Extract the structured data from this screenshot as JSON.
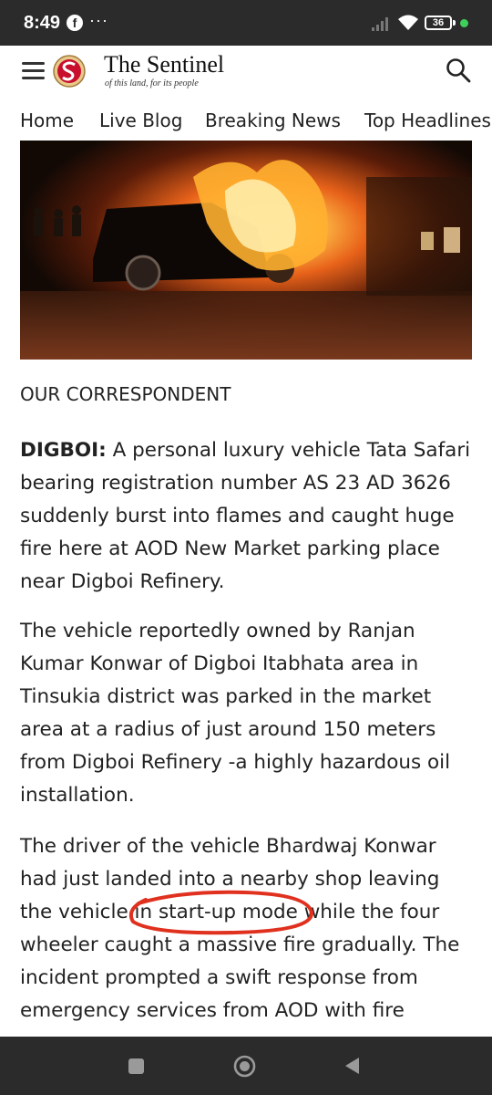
{
  "status_bar": {
    "time": "8:49",
    "notification_app": "f",
    "more_indicator": "···",
    "battery_level": "36",
    "icons": [
      "facebook-icon",
      "signal-icon",
      "wifi-icon",
      "battery-icon"
    ]
  },
  "header": {
    "brand_name": "The Sentinel",
    "tagline": "of this land, for its people",
    "icons": [
      "menu-icon",
      "sentinel-logo",
      "search-icon"
    ]
  },
  "nav": {
    "items": [
      "Home",
      "Live Blog",
      "Breaking News",
      "Top Headlines"
    ]
  },
  "article": {
    "byline": "OUR CORRESPONDENT",
    "dateline": "DIGBOI:",
    "paragraph1": " A personal luxury vehicle Tata Safari bearing registration number AS 23 AD 3626 suddenly burst into flames and caught huge fire here at AOD New Market parking place near Digboi Refinery.",
    "paragraph2": "The vehicle reportedly owned by Ranjan Kumar Konwar of Digboi Itabhata area in Tinsukia district was parked in the market area at a radius of just around 150 meters from Digboi Refinery -a highly hazardous oil installation.",
    "paragraph3": "The driver of the vehicle Bhardwaj Konwar had just landed into a nearby shop leaving the vehicle in start-up mode while the four wheeler caught a massive fire gradually. The incident prompted a swift response from emergency services from AOD with fire"
  },
  "colors": {
    "status_bar": "#2b2b2b",
    "annotation_circle": "#e0301e",
    "logo_red": "#c8102e",
    "battery_dot": "#3fcf5b"
  },
  "system_nav": {
    "icons": [
      "recents-icon",
      "home-icon",
      "back-icon"
    ]
  }
}
